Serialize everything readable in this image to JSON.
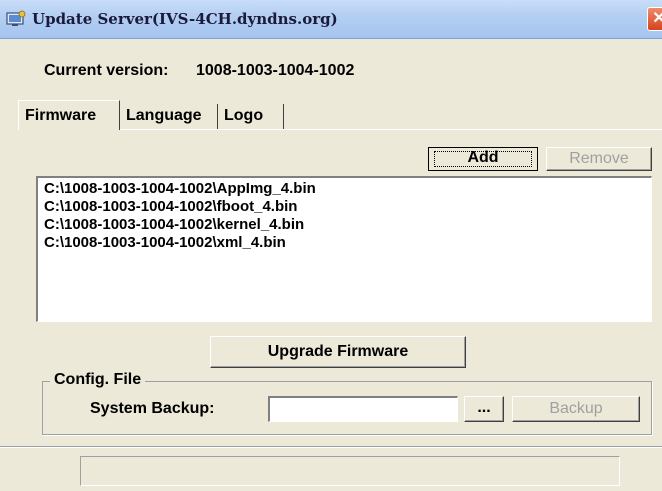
{
  "window": {
    "title": "Update Server(IVS-4CH.dyndns.org)",
    "icon": "update-server-app-icon",
    "close_icon": "close-icon",
    "close_glyph": "✕"
  },
  "version": {
    "label": "Current version:",
    "value": "1008-1003-1004-1002"
  },
  "tabs": [
    {
      "label": "Firmware",
      "active": true
    },
    {
      "label": "Language",
      "active": false
    },
    {
      "label": "Logo",
      "active": false
    }
  ],
  "firmware": {
    "add_label": "Add",
    "remove_label": "Remove",
    "files": [
      "C:\\1008-1003-1004-1002\\AppImg_4.bin",
      "C:\\1008-1003-1004-1002\\fboot_4.bin",
      "C:\\1008-1003-1004-1002\\kernel_4.bin",
      "C:\\1008-1003-1004-1002\\xml_4.bin"
    ],
    "upgrade_label": "Upgrade Firmware"
  },
  "config": {
    "group_label": "Config. File",
    "backup_label": "System Backup:",
    "backup_path_value": "",
    "browse_label": "...",
    "backup_button_label": "Backup"
  },
  "status": {
    "text": ""
  }
}
